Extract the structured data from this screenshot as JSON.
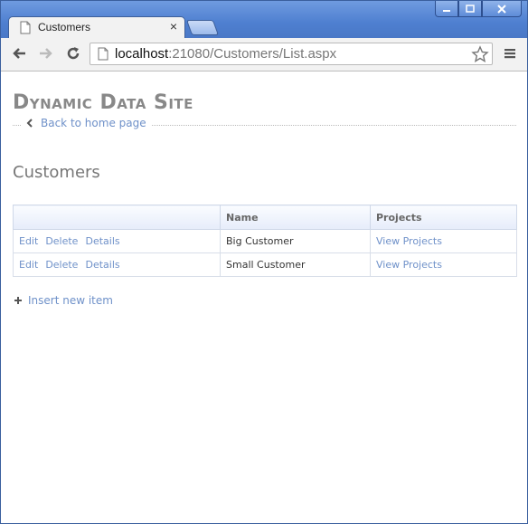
{
  "browser": {
    "tab_title": "Customers",
    "tab_close": "×",
    "url_host": "localhost",
    "url_rest": ":21080/Customers/List.aspx"
  },
  "site": {
    "title": "Dynamic Data Site",
    "back_link": "Back to home page"
  },
  "page": {
    "heading": "Customers"
  },
  "table": {
    "headers": [
      "",
      "Name",
      "Projects"
    ],
    "rows": [
      {
        "edit": "Edit",
        "delete": "Delete",
        "details": "Details",
        "name": "Big Customer",
        "projects": "View Projects"
      },
      {
        "edit": "Edit",
        "delete": "Delete",
        "details": "Details",
        "name": "Small Customer",
        "projects": "View Projects"
      }
    ]
  },
  "insert_link": "Insert new item",
  "colors": {
    "link": "#6f91c9",
    "title_gray": "#888888",
    "titlebar_blue": "#4e7fd0"
  }
}
